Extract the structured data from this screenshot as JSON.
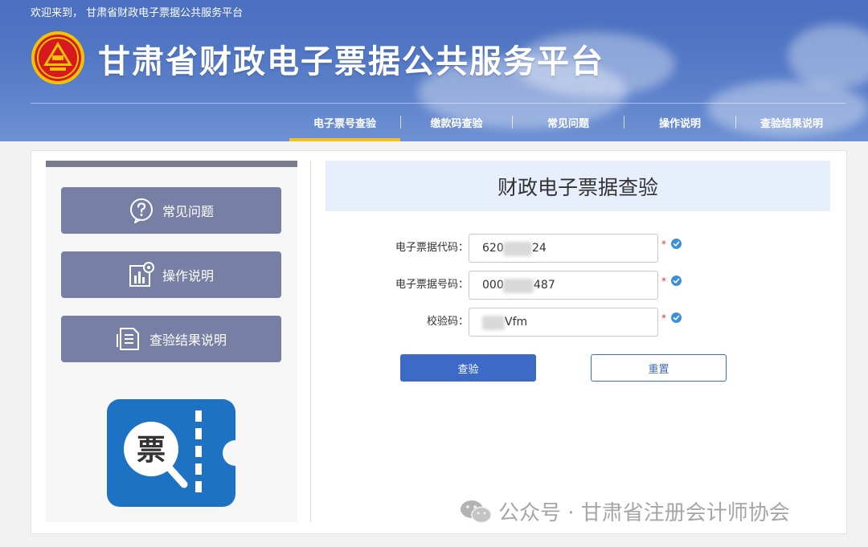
{
  "header": {
    "welcome": "欢迎来到， 甘肃省财政电子票据公共服务平台",
    "title": "甘肃省财政电子票据公共服务平台"
  },
  "nav": {
    "items": [
      {
        "label": "电子票号查验",
        "active": true
      },
      {
        "label": "缴款码查验",
        "active": false
      },
      {
        "label": "常见问题",
        "active": false
      },
      {
        "label": "操作说明",
        "active": false
      },
      {
        "label": "查验结果说明",
        "active": false
      }
    ]
  },
  "sidebar": {
    "items": [
      {
        "label": "常见问题",
        "icon": "question-icon"
      },
      {
        "label": "操作说明",
        "icon": "chart-settings-icon"
      },
      {
        "label": "查验结果说明",
        "icon": "document-icon"
      }
    ],
    "app_icon_text": "票"
  },
  "form": {
    "title": "财政电子票据查验",
    "fields": [
      {
        "label": "电子票据代码：",
        "value_prefix": "620",
        "value_suffix": "24"
      },
      {
        "label": "电子票据号码：",
        "value_prefix": "000",
        "value_suffix": "487"
      },
      {
        "label": "校验码：",
        "value_prefix": "",
        "value_suffix": "Vfm"
      }
    ],
    "required_mark": "*",
    "submit_label": "查验",
    "reset_label": "重置"
  },
  "watermark": {
    "text": "公众号 · 甘肃省注册会计师协会"
  },
  "colors": {
    "header_blue": "#5479c6",
    "nav_active_underline": "#f3c021",
    "sidebar_button": "#787fa4",
    "primary_button": "#3d6ac6",
    "title_panel_bg": "#e8effc",
    "app_icon_blue": "#1d72c4",
    "logo_red": "#d7191f",
    "logo_gold": "#f6c300"
  }
}
